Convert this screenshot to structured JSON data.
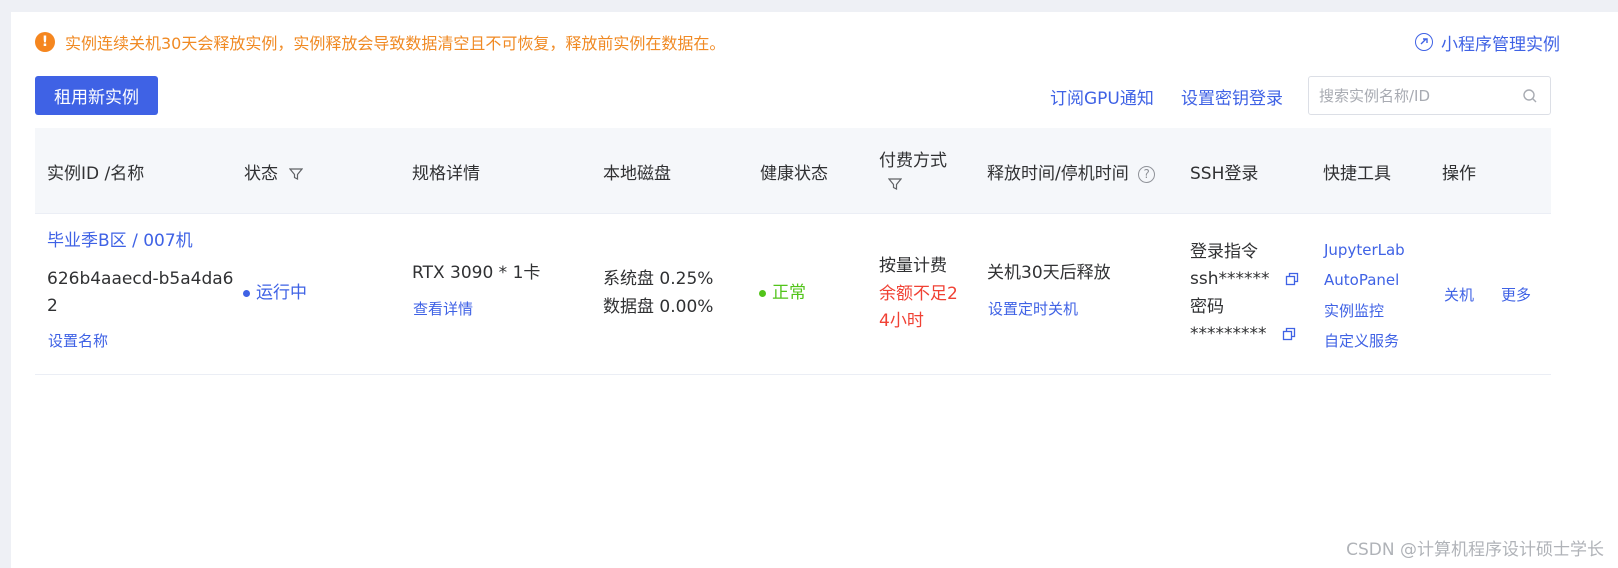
{
  "notice": {
    "icon": "warning-icon",
    "text": "实例连续关机30天会释放实例，实例释放会导致数据清空且不可恢复，释放前实例在数据在。",
    "color": "#f08a24"
  },
  "mini_program": {
    "label": "小程序管理实例",
    "icon": "link-icon"
  },
  "toolbar": {
    "rent_label": "租用新实例",
    "subscribe_label": "订阅GPU通知",
    "ssh_key_label": "设置密钥登录",
    "search_placeholder": "搜索实例名称/ID"
  },
  "columns": {
    "id_name": "实例ID /名称",
    "status": "状态",
    "spec": "规格详情",
    "disk": "本地磁盘",
    "health": "健康状态",
    "billing": "付费方式",
    "release": "释放时间/停机时间",
    "ssh": "SSH登录",
    "tools": "快捷工具",
    "ops": "操作"
  },
  "rows": [
    {
      "name": "毕业季B区 / 007机",
      "id_line1": "626b4aaecd-b5a4da6",
      "id_line2": "2",
      "set_name": "设置名称",
      "status": "运行中",
      "spec": "RTX 3090 * 1卡",
      "spec_detail": "查看详情",
      "disk_system": "系统盘 0.25%",
      "disk_data": "数据盘 0.00%",
      "health": "正常",
      "billing": "按量计费",
      "billing_warn_1": "余额不足2",
      "billing_warn_2": "4小时",
      "release": "关机30天后释放",
      "set_shutdown": "设置定时关机",
      "ssh_cmd_label": "登录指令",
      "ssh_cmd": "ssh******",
      "ssh_pwd_label": "密码",
      "ssh_pwd": "*********",
      "tools": [
        "JupyterLab",
        "AutoPanel",
        "实例监控",
        "自定义服务"
      ],
      "op_shutdown": "关机",
      "op_more": "更多"
    }
  ],
  "colors": {
    "accent": "#3f62e5",
    "warning": "#f08a24",
    "error": "#f04134",
    "success": "#52c41a"
  },
  "watermark": "CSDN @计算机程序设计硕士学长"
}
